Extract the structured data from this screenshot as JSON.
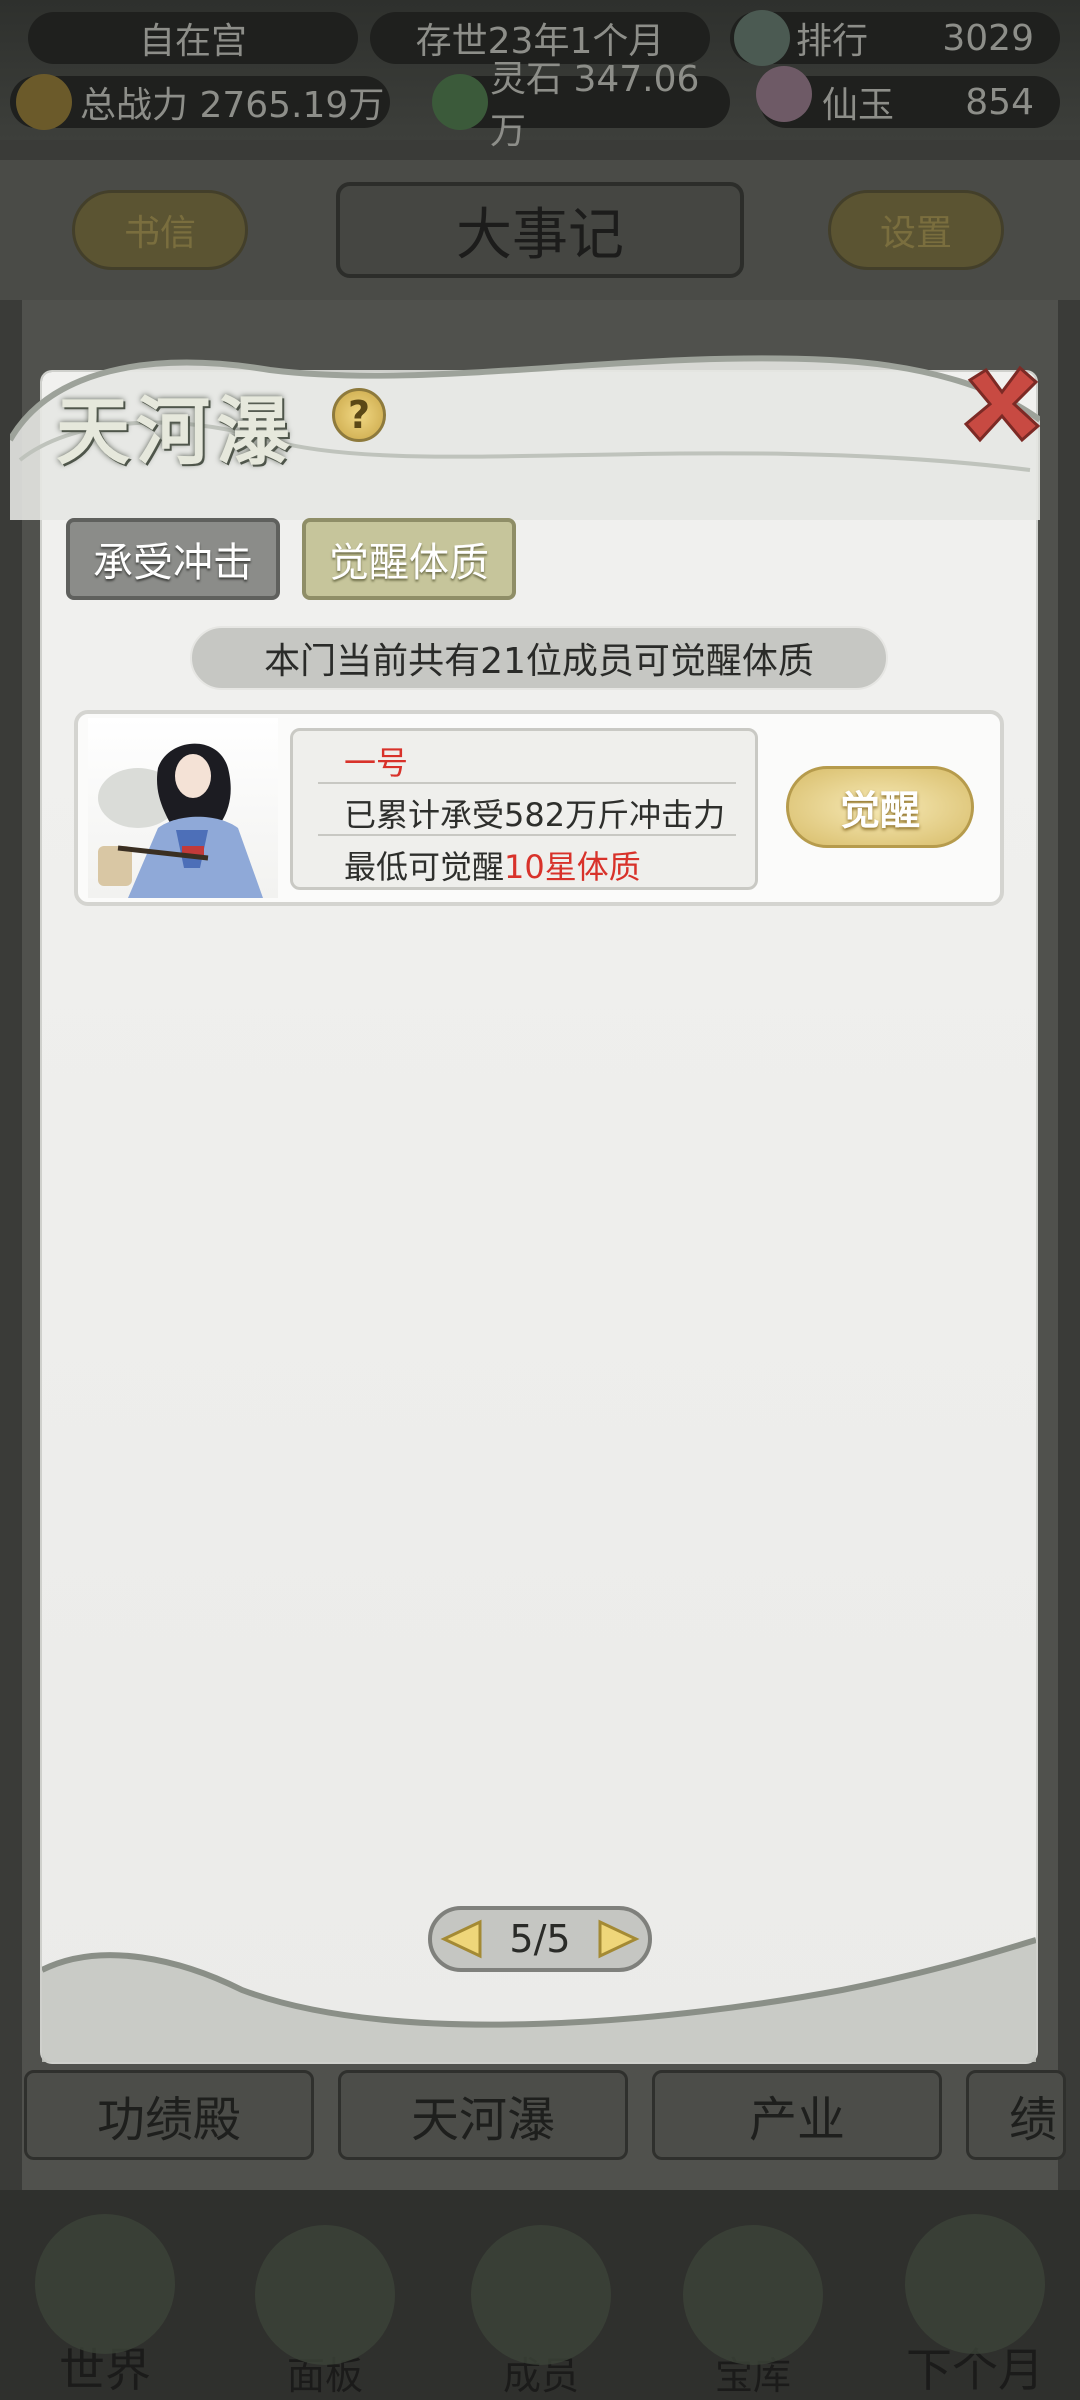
{
  "header": {
    "sect_name": "自在宫",
    "era": "存世23年1个月",
    "rank_label": "排行",
    "rank_value": "3029",
    "power_label": "总战力 2765.19万",
    "spirit_stone": "灵石 347.06万",
    "jade_label": "仙玉",
    "jade_value": "854"
  },
  "nav": {
    "letters_label": "书信",
    "title": "大事记",
    "settings_label": "设置"
  },
  "background_tabs": [
    "功绩殿",
    "天河瀑",
    "产业",
    "绩"
  ],
  "bottom_nav": [
    "世界",
    "面板",
    "成员",
    "宝库",
    "下个月"
  ],
  "modal": {
    "title": "天河瀑",
    "help_label": "?",
    "tabs": [
      "承受冲击",
      "觉醒体质"
    ],
    "active_tab": "觉醒体质",
    "banner": "本门当前共有21位成员可觉醒体质",
    "member": {
      "name": "一号",
      "line2": "已累计承受582万斤冲击力",
      "line3_prefix": "最低可觉醒",
      "line3_highlight": "10星体质",
      "action_label": "觉醒"
    },
    "pager": "5/5"
  },
  "colors": {
    "accent_red": "#d8322a",
    "gold_button": "#d8bd6a",
    "active_tab": "#c6c59b"
  }
}
